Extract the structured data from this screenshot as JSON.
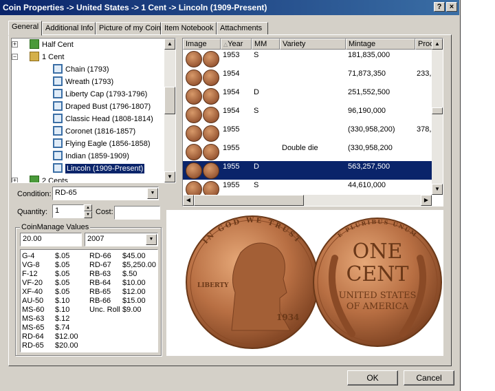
{
  "window": {
    "title": "Coin Properties -> United States -> 1 Cent -> Lincoln (1909-Present)",
    "help_btn": "?",
    "close_btn": "×"
  },
  "tabs": [
    {
      "label": "General"
    },
    {
      "label": "Additional Info"
    },
    {
      "label": "Picture of my Coin"
    },
    {
      "label": "Item Notebook"
    },
    {
      "label": "Attachments"
    }
  ],
  "tree": {
    "items": [
      {
        "label": "Half Cent",
        "expander": "+"
      },
      {
        "label": "1 Cent",
        "expander": "−"
      },
      {
        "label": "Chain (1793)"
      },
      {
        "label": "Wreath (1793)"
      },
      {
        "label": "Liberty Cap (1793-1796)"
      },
      {
        "label": "Draped Bust (1796-1807)"
      },
      {
        "label": "Classic Head (1808-1814)"
      },
      {
        "label": "Coronet (1816-1857)"
      },
      {
        "label": "Flying Eagle (1856-1858)"
      },
      {
        "label": "Indian (1859-1909)"
      },
      {
        "label": "Lincoln (1909-Present)"
      },
      {
        "label": "2 Cents",
        "expander": "+"
      }
    ]
  },
  "form": {
    "condition_label": "Condition:",
    "condition_value": "RD-65",
    "quantity_label": "Quantity:",
    "quantity_value": "1",
    "cost_label": "Cost:",
    "cost_value": ""
  },
  "values": {
    "group_title": "CoinManage Values",
    "price_value": "20.00",
    "year_value": "2007",
    "col1": [
      {
        "grade": "G-4",
        "price": "$.05"
      },
      {
        "grade": "VG-8",
        "price": "$.05"
      },
      {
        "grade": "F-12",
        "price": "$.05"
      },
      {
        "grade": "VF-20",
        "price": "$.05"
      },
      {
        "grade": "XF-40",
        "price": "$.05"
      },
      {
        "grade": "AU-50",
        "price": "$.10"
      },
      {
        "grade": "MS-60",
        "price": "$.10"
      },
      {
        "grade": "MS-63",
        "price": "$.12"
      },
      {
        "grade": "MS-65",
        "price": "$.74"
      },
      {
        "grade": "RD-64",
        "price": "$12.00"
      },
      {
        "grade": "RD-65",
        "price": "$20.00"
      }
    ],
    "col2": [
      {
        "grade": "RD-66",
        "price": "$45.00"
      },
      {
        "grade": "RD-67",
        "price": "$5,250.00"
      },
      {
        "grade": "RB-63",
        "price": "$.50"
      },
      {
        "grade": "RB-64",
        "price": "$10.00"
      },
      {
        "grade": "RB-65",
        "price": "$12.00"
      },
      {
        "grade": "RB-66",
        "price": "$15.00"
      },
      {
        "grade": "Unc. Roll",
        "price": "$9.00"
      }
    ]
  },
  "grid": {
    "headers": {
      "image": "Image",
      "year": "Year",
      "mm": "MM",
      "variety": "Variety",
      "mintage": "Mintage",
      "proof": "Proo"
    },
    "rows": [
      {
        "year": "1953",
        "mm": "S",
        "variety": "",
        "mintage": "181,835,000",
        "proof": ""
      },
      {
        "year": "1954",
        "mm": "",
        "variety": "",
        "mintage": "71,873,350",
        "proof": "233,3"
      },
      {
        "year": "1954",
        "mm": "D",
        "variety": "",
        "mintage": "251,552,500",
        "proof": ""
      },
      {
        "year": "1954",
        "mm": "S",
        "variety": "",
        "mintage": "96,190,000",
        "proof": ""
      },
      {
        "year": "1955",
        "mm": "",
        "variety": "",
        "mintage": "(330,958,200)",
        "proof": "378,2"
      },
      {
        "year": "1955",
        "mm": "",
        "variety": "Double die",
        "mintage": "(330,958,200",
        "proof": ""
      },
      {
        "year": "1955",
        "mm": "D",
        "variety": "",
        "mintage": "563,257,500",
        "proof": ""
      },
      {
        "year": "1955",
        "mm": "S",
        "variety": "",
        "mintage": "44,610,000",
        "proof": ""
      }
    ],
    "selected_index": 6
  },
  "coin": {
    "obverse_motto": "IN GOD WE TRUST",
    "obverse_liberty": "LIBERTY",
    "obverse_year": "1934",
    "reverse_motto": "E PLURIBUS UNUM",
    "reverse_line1": "ONE",
    "reverse_line2": "CENT",
    "reverse_line3": "UNITED STATES",
    "reverse_line4": "OF AMERICA"
  },
  "buttons": {
    "ok": "OK",
    "cancel": "Cancel"
  },
  "colors": {
    "title_start": "#0a246a",
    "selection": "#0a246a",
    "copper": "#b86f43"
  }
}
